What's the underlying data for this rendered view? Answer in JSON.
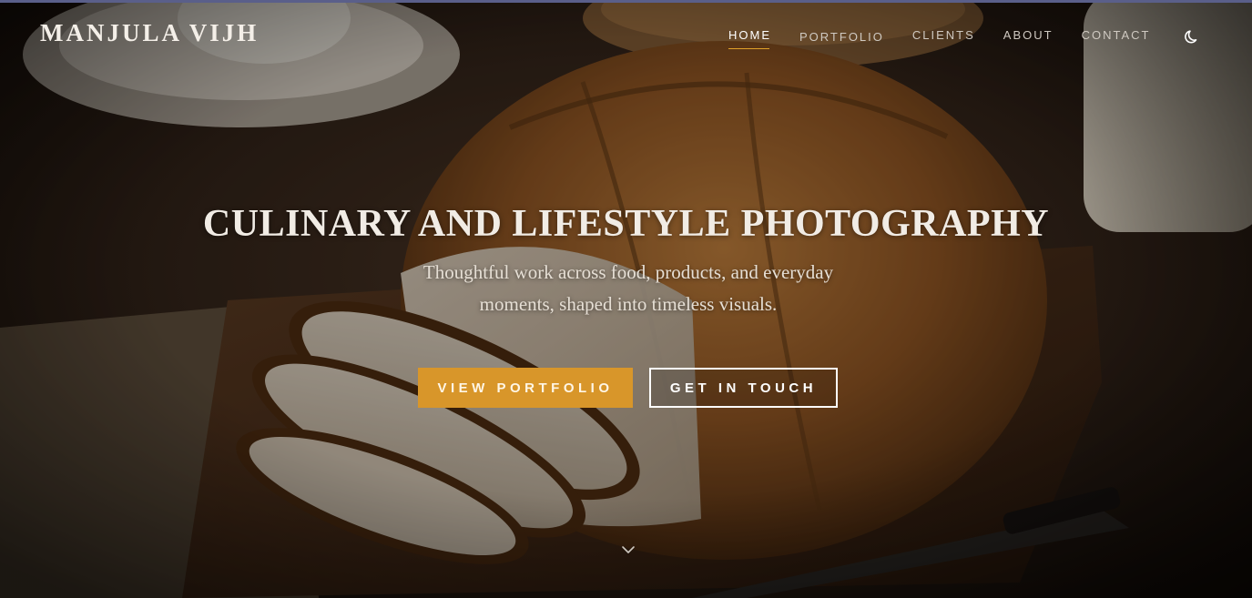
{
  "header": {
    "brand": "MANJULA VIJH",
    "nav": [
      {
        "label": "HOME",
        "active": true
      },
      {
        "label": "PORTFOLIO",
        "active": false
      },
      {
        "label": "CLIENTS",
        "active": false
      },
      {
        "label": "ABOUT",
        "active": false
      },
      {
        "label": "CONTACT",
        "active": false
      }
    ],
    "theme_toggle_icon": "moon-icon"
  },
  "hero": {
    "title": "CULINARY AND LIFESTYLE PHOTOGRAPHY",
    "subtitle_line1": "Thoughtful work across food, products, and everyday",
    "subtitle_line2": "moments, shaped into timeless visuals.",
    "primary_button": "VIEW PORTFOLIO",
    "secondary_button": "GET IN TOUCH",
    "scroll_icon": "chevron-down-icon"
  },
  "colors": {
    "accent": "#d8962a",
    "text": "#f1ece5",
    "top_bar": "#5a5f8a"
  }
}
